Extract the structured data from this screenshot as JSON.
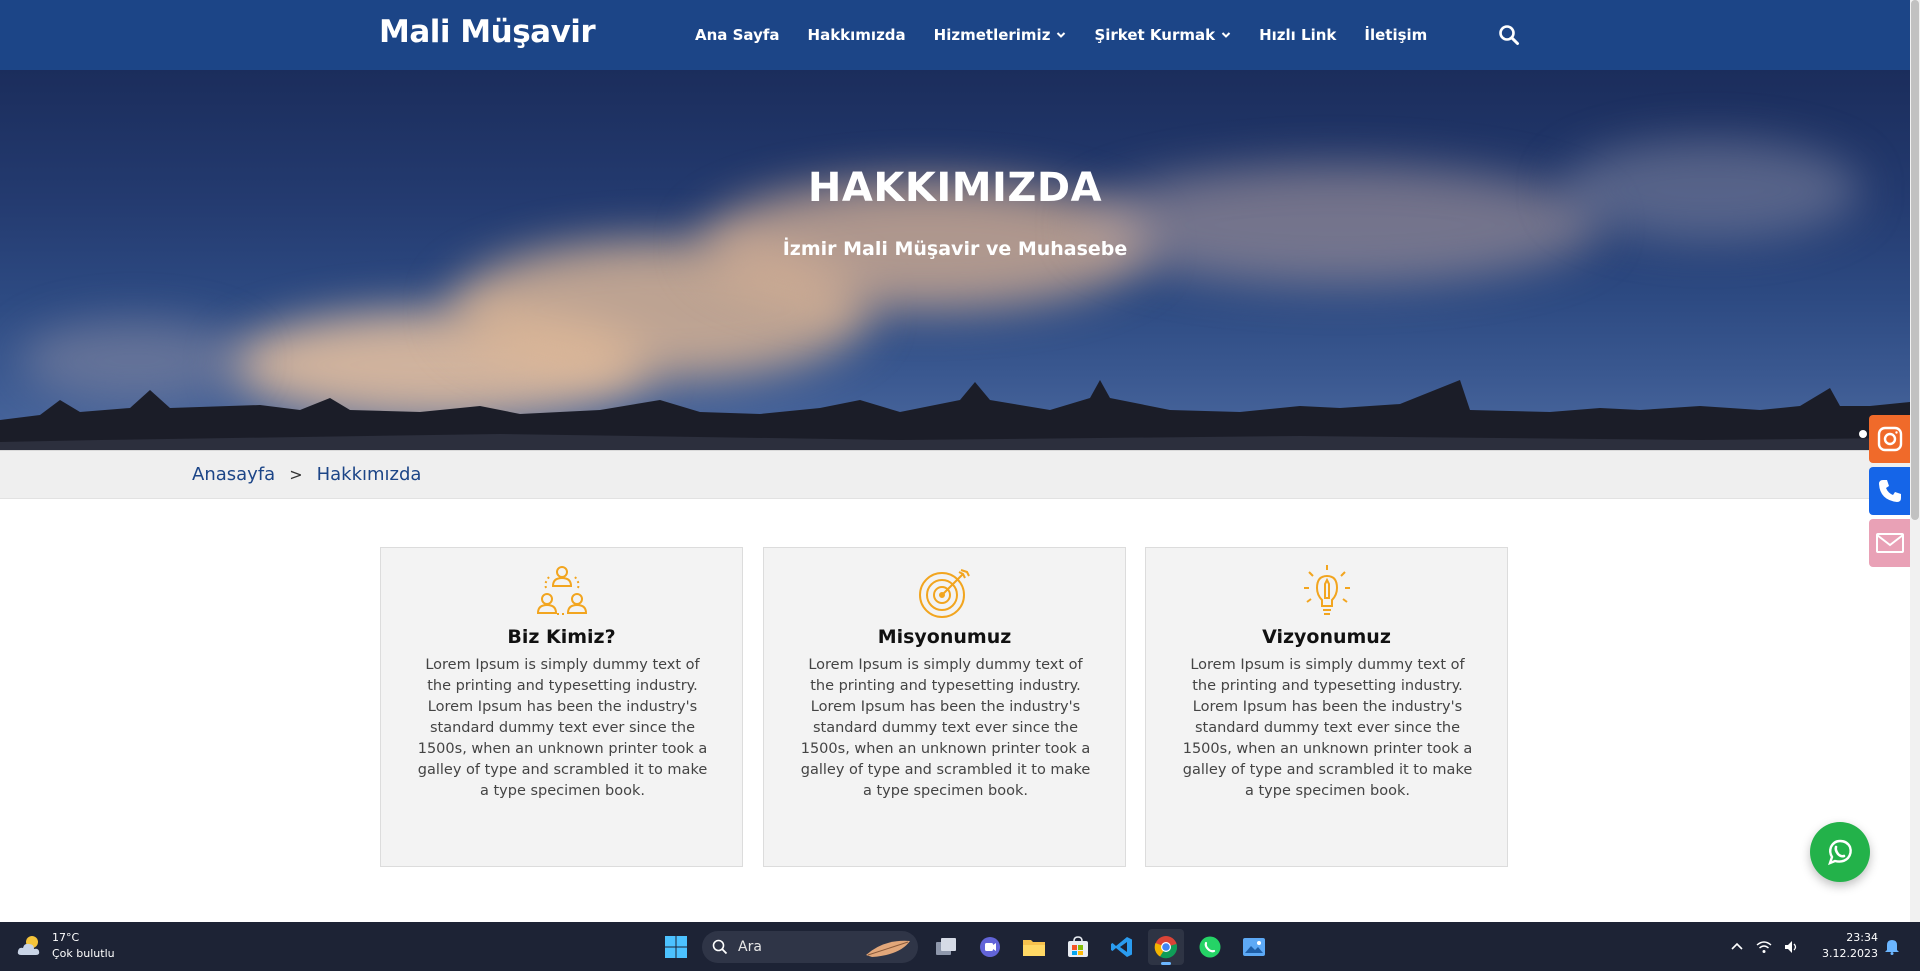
{
  "navbar": {
    "brand": "Mali Müşavir",
    "items": [
      {
        "label": "Ana Sayfa",
        "has_dropdown": false
      },
      {
        "label": "Hakkımızda",
        "has_dropdown": false
      },
      {
        "label": "Hizmetlerimiz",
        "has_dropdown": true
      },
      {
        "label": "Şirket Kurmak",
        "has_dropdown": true
      },
      {
        "label": "Hızlı Link",
        "has_dropdown": false
      },
      {
        "label": "İletişim",
        "has_dropdown": false
      }
    ],
    "search_icon": "search-icon",
    "bg_color": "#1c4587"
  },
  "hero": {
    "title": "HAKKIMIZDA",
    "subtitle": "İzmir Mali Müşavir ve Muhasebe"
  },
  "breadcrumb": {
    "home": "Anasayfa",
    "separator": ">",
    "current": "Hakkımızda"
  },
  "cards": [
    {
      "icon": "people-network-icon",
      "title": "Biz Kimiz?",
      "text": "Lorem Ipsum is simply dummy text of the printing and typesetting industry. Lorem Ipsum has been the industry's standard dummy text ever since the 1500s, when an unknown printer took a galley of type and scrambled it to make a type specimen book."
    },
    {
      "icon": "target-icon",
      "title": "Misyonumuz",
      "text": "Lorem Ipsum is simply dummy text of the printing and typesetting industry. Lorem Ipsum has been the industry's standard dummy text ever since the 1500s, when an unknown printer took a galley of type and scrambled it to make a type specimen book."
    },
    {
      "icon": "lightbulb-pencil-icon",
      "title": "Vizyonumuz",
      "text": "Lorem Ipsum is simply dummy text of the printing and typesetting industry. Lorem Ipsum has been the industry's standard dummy text ever since the 1500s, when an unknown printer took a galley of type and scrambled it to make a type specimen book."
    }
  ],
  "side_buttons": [
    {
      "icon": "instagram-icon",
      "color": "#f06a2a"
    },
    {
      "icon": "phone-icon",
      "color": "#1565e8"
    },
    {
      "icon": "mail-icon",
      "color": "#e9a1b6"
    }
  ],
  "whatsapp": {
    "icon": "whatsapp-icon",
    "color": "#23b24a"
  },
  "taskbar": {
    "weather_temp": "17°C",
    "weather_desc": "Çok bulutlu",
    "search_placeholder": "Ara",
    "apps": [
      "windows-start-icon",
      "task-view-icon",
      "teams-chat-icon",
      "file-explorer-icon",
      "microsoft-store-icon",
      "vscode-icon",
      "chrome-icon",
      "whatsapp-app-icon",
      "photos-icon"
    ],
    "active_app": "chrome-icon",
    "time": "23:34",
    "date": "3.12.2023"
  },
  "accent_color": "#f2a51f"
}
